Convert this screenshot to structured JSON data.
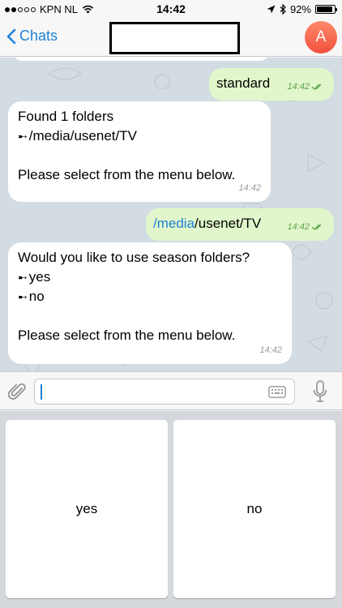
{
  "status_bar": {
    "carrier": "KPN NL",
    "time": "14:42",
    "battery": "92%",
    "battery_level": 0.92
  },
  "nav": {
    "back_label": "Chats",
    "avatar_letter": "A",
    "avatar_color": "#f0503d"
  },
  "messages": [
    {
      "direction": "out",
      "text": "standard",
      "time": "14:42"
    },
    {
      "direction": "in",
      "lines": [
        "Found 1 folders",
        "/media/usenet/TV",
        "",
        "Please select from the menu below."
      ],
      "time": "14:42"
    },
    {
      "direction": "out",
      "link_text": "/media",
      "text": "/usenet/TV",
      "time": "14:42"
    },
    {
      "direction": "in",
      "lines": [
        "Would you like to use season folders?",
        "yes",
        "no",
        "",
        "Please select from the menu below."
      ],
      "time": "14:42"
    }
  ],
  "keyboard_buttons": [
    "yes",
    "no"
  ],
  "colors": {
    "accent": "#1f82d6",
    "outgoing_bubble": "#e1f7cb",
    "chat_background": "#d4dce3",
    "read_check": "#5ea34a"
  },
  "icons": {
    "wifi": "wifi-icon",
    "location": "location-arrow-icon",
    "bluetooth": "bluetooth-icon",
    "attach": "paperclip-icon",
    "keyboard": "keyboard-icon",
    "microphone": "microphone-icon",
    "double_check": "double-check-icon",
    "arrow_bullet": "arrow-bullet-icon"
  }
}
